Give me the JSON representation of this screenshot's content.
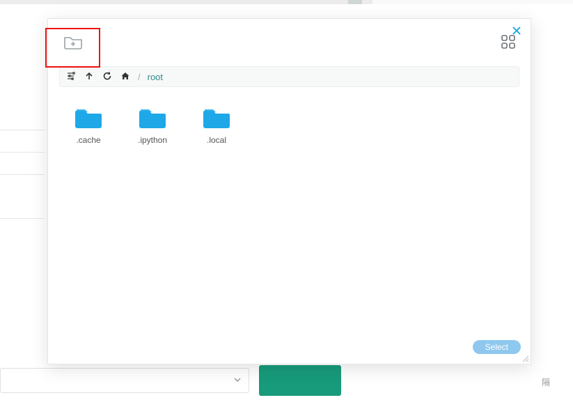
{
  "background": {
    "right_text": "隔"
  },
  "modal": {
    "new_folder_tooltip": "New Folder",
    "view_mode_tooltip": "Grid View",
    "close_tooltip": "Close",
    "pathbar": {
      "filter_tooltip": "Filter",
      "up_tooltip": "Up",
      "reload_tooltip": "Reload",
      "home_tooltip": "Home",
      "separator": "/",
      "current": "root"
    },
    "folders": [
      {
        "name": ".cache"
      },
      {
        "name": ".ipython"
      },
      {
        "name": ".local"
      }
    ],
    "select_label": "Select"
  },
  "colors": {
    "folder_fill": "#1ea8e8",
    "accent": "#29abe2",
    "highlight_border": "#e11"
  }
}
